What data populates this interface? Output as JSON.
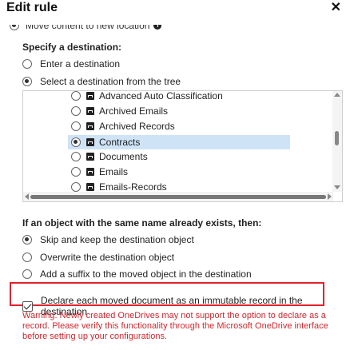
{
  "dialog": {
    "title": "Edit rule",
    "close_icon": "close-icon",
    "close_glyph": "✕"
  },
  "move_option": {
    "label": "Move content to new location",
    "info_glyph": "i",
    "checked": true
  },
  "destination": {
    "heading": "Specify a destination:",
    "options": [
      {
        "label": "Enter a destination",
        "checked": false
      },
      {
        "label": "Select a destination from the tree",
        "checked": true
      }
    ]
  },
  "tree": {
    "items": [
      {
        "label": "Advanced Auto Classification",
        "checked": false
      },
      {
        "label": "Archived Emails",
        "checked": false
      },
      {
        "label": "Archived Records",
        "checked": false
      },
      {
        "label": "Contracts",
        "checked": true
      },
      {
        "label": "Documents",
        "checked": false
      },
      {
        "label": "Emails",
        "checked": false
      },
      {
        "label": "Emails-Records",
        "checked": false
      }
    ],
    "icon": "library-icon",
    "highlight_color": "#cfe3f7"
  },
  "conflict": {
    "heading": "If an object with the same name already exists, then:",
    "options": [
      {
        "label": "Skip and keep the destination object",
        "checked": true
      },
      {
        "label": "Overwrite the destination object",
        "checked": false
      },
      {
        "label": "Add a suffix to the moved object in the destination",
        "checked": false
      }
    ]
  },
  "declare": {
    "label": "Declare each moved document as an immutable record in the destination",
    "checked": true,
    "highlight_color": "#e0242b"
  },
  "warning": {
    "text": "Warning: Newly created OneDrives may not support the option to declare as a record. Please verify this functionality through the Microsoft OneDrive interface before setting up your configurations.",
    "color": "#d3262c"
  }
}
